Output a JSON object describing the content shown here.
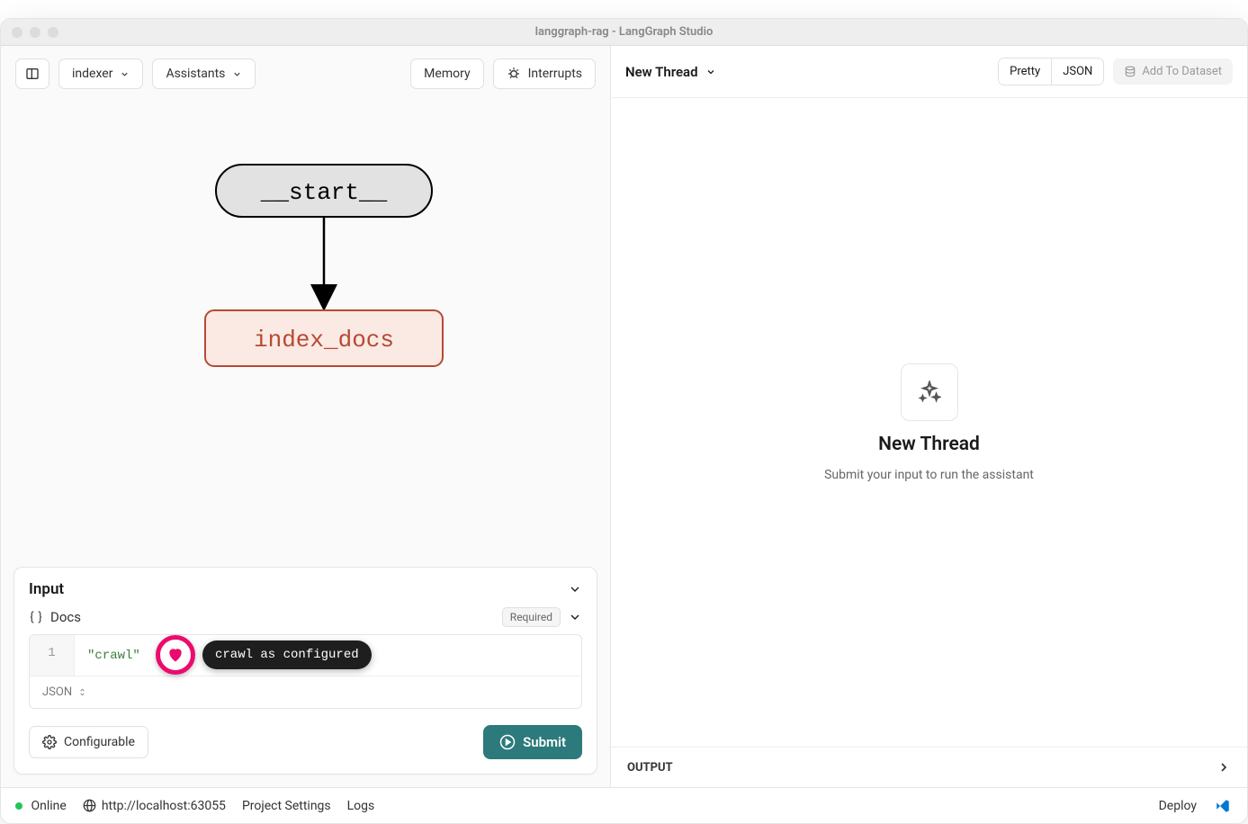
{
  "window": {
    "title": "langgraph-rag - LangGraph Studio"
  },
  "toolbar_left": {
    "graph_selector": "indexer",
    "assistants": "Assistants",
    "memory": "Memory",
    "interrupts": "Interrupts"
  },
  "graph": {
    "start_label": "__start__",
    "node_label": "index_docs"
  },
  "input_panel": {
    "title": "Input",
    "docs_label": "Docs",
    "required_badge": "Required",
    "code_line_number": "1",
    "code_value": "\"crawl\"",
    "editor_mode": "JSON",
    "configurable": "Configurable",
    "submit": "Submit"
  },
  "annotation": {
    "tooltip": "crawl as configured"
  },
  "right": {
    "thread_label": "New Thread",
    "pretty": "Pretty",
    "json": "JSON",
    "add_dataset": "Add To Dataset",
    "empty_title": "New Thread",
    "empty_sub": "Submit your input to run the assistant",
    "output": "OUTPUT"
  },
  "status": {
    "online": "Online",
    "url": "http://localhost:63055",
    "settings": "Project Settings",
    "logs": "Logs",
    "deploy": "Deploy"
  }
}
